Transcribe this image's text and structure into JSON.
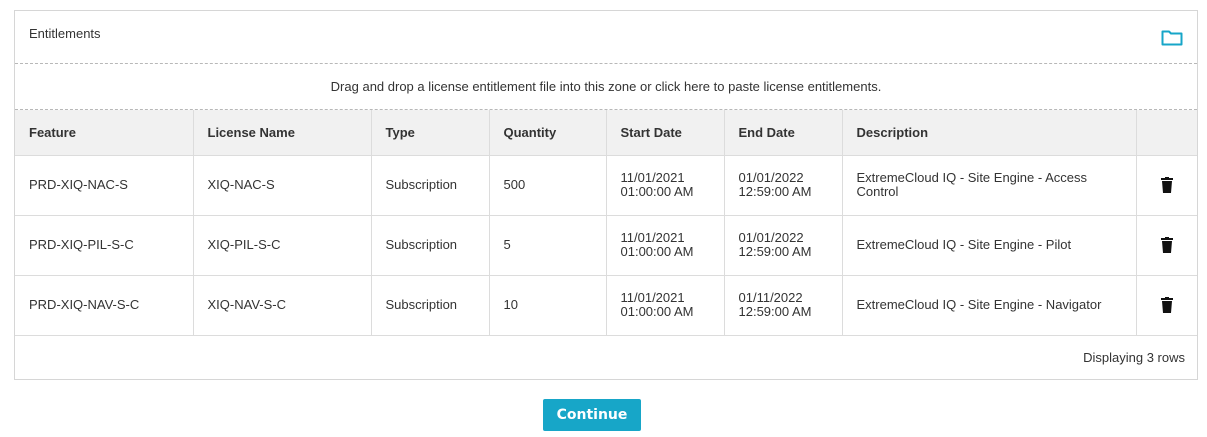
{
  "panel": {
    "title": "Entitlements",
    "folder_icon": "folder-icon",
    "accent_color": "#17a6c8"
  },
  "dropzone": {
    "text": "Drag and drop a license entitlement file into this zone or click here to paste license entitlements."
  },
  "table": {
    "columns": [
      "Feature",
      "License Name",
      "Type",
      "Quantity",
      "Start Date",
      "End Date",
      "Description",
      ""
    ],
    "rows": [
      {
        "feature": "PRD-XIQ-NAC-S",
        "license_name": "XIQ-NAC-S",
        "type": "Subscription",
        "quantity": "500",
        "start_date": "11/01/2021",
        "start_time": "01:00:00 AM",
        "end_date": "01/01/2022",
        "end_time": "12:59:00 AM",
        "description": "ExtremeCloud IQ - Site Engine - Access Control"
      },
      {
        "feature": "PRD-XIQ-PIL-S-C",
        "license_name": "XIQ-PIL-S-C",
        "type": "Subscription",
        "quantity": "5",
        "start_date": "11/01/2021",
        "start_time": "01:00:00 AM",
        "end_date": "01/01/2022",
        "end_time": "12:59:00 AM",
        "description": "ExtremeCloud IQ - Site Engine - Pilot"
      },
      {
        "feature": "PRD-XIQ-NAV-S-C",
        "license_name": "XIQ-NAV-S-C",
        "type": "Subscription",
        "quantity": "10",
        "start_date": "11/01/2021",
        "start_time": "01:00:00 AM",
        "end_date": "01/11/2022",
        "end_time": "12:59:00 AM",
        "description": "ExtremeCloud IQ - Site Engine - Navigator"
      }
    ],
    "row_action_icon": "trash-icon"
  },
  "pager": {
    "status": "Displaying 3 rows"
  },
  "footer": {
    "continue_label": "Continue"
  }
}
